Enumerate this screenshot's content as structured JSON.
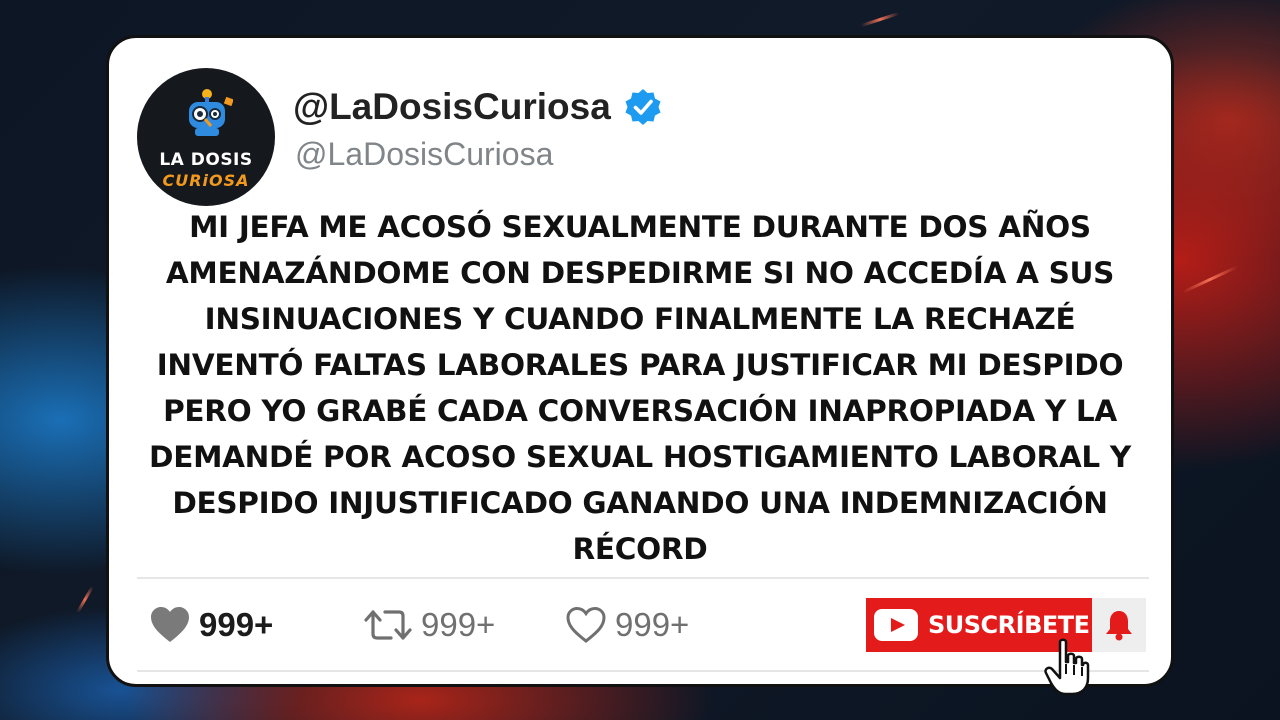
{
  "profile": {
    "display_name": "@LaDosisCuriosa",
    "handle": "@LaDosisCuriosa",
    "avatar_text_line1": "LA DOSIS",
    "avatar_text_line2": "CURiOSA",
    "verified": true
  },
  "post": {
    "lines": [
      "MI JEFA ME ACOSÓ SEXUALMENTE DURANTE DOS AÑOS",
      "AMENAZÁNDOME CON DESPEDIRME SI NO ACCEDÍA A SUS",
      "INSINUACIONES Y CUANDO FINALMENTE LA RECHAZÉ",
      "INVENTÓ FALTAS LABORALES PARA JUSTIFICAR MI DESPIDO",
      "PERO YO GRABÉ CADA CONVERSACIÓN INAPROPIADA Y LA",
      "DEMANDÉ POR ACOSO SEXUAL HOSTIGAMIENTO LABORAL Y",
      "DESPIDO INJUSTIFICADO GANANDO UNA INDEMNIZACIÓN",
      "RÉCORD"
    ]
  },
  "stats": {
    "likes": "999+",
    "retweets": "999+",
    "favorites": "999+"
  },
  "subscribe": {
    "label": "SUSCRÍBETE"
  },
  "colors": {
    "verified_blue": "#1d9bf0",
    "subscribe_red": "#e31b1b",
    "brand_orange": "#f39a1e"
  },
  "icons": [
    "heart-filled-icon",
    "retweet-icon",
    "heart-outline-icon",
    "youtube-play-icon",
    "bell-icon",
    "hand-cursor-icon",
    "verified-badge-icon"
  ]
}
